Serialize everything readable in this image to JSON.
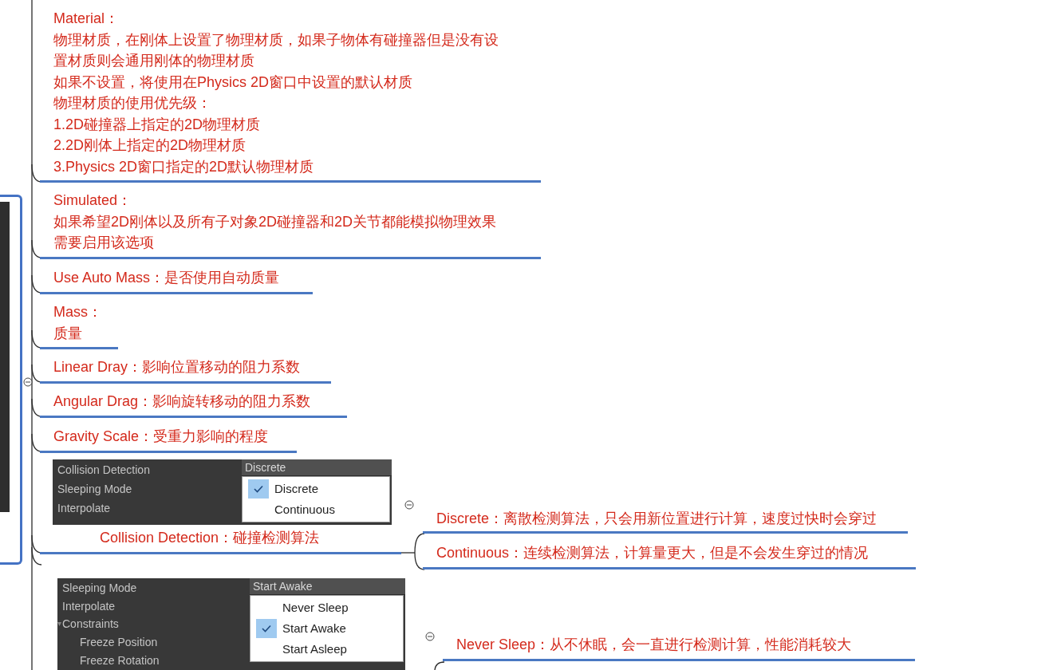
{
  "topics": [
    {
      "kind": "topic",
      "lines": [
        "Material：",
        "物理材质，在刚体上设置了物理材质，如果子物体有碰撞器但是没有设",
        "置材质则会通用刚体的物理材质",
        "如果不设置，将使用在Physics 2D窗口中设置的默认材质",
        "物理材质的使用优先级：",
        "1.2D碰撞器上指定的2D物理材质",
        "2.2D刚体上指定的2D物理材质",
        "3.Physics 2D窗口指定的2D默认物理材质"
      ]
    },
    {
      "kind": "topic",
      "lines": [
        "Simulated：",
        "如果希望2D刚体以及所有子对象2D碰撞器和2D关节都能模拟物理效果",
        "需要启用该选项"
      ]
    },
    {
      "kind": "topic",
      "lines": [
        "Use Auto Mass：是否使用自动质量"
      ]
    },
    {
      "kind": "topic",
      "lines": [
        "Mass：",
        "质量"
      ]
    },
    {
      "kind": "topic",
      "lines": [
        "Linear Dray：影响位置移动的阻力系数"
      ]
    },
    {
      "kind": "topic",
      "lines": [
        "Angular Drag：影响旋转移动的阻力系数"
      ]
    },
    {
      "kind": "topic",
      "lines": [
        "Gravity Scale：受重力影响的程度"
      ]
    },
    {
      "kind": "screenshot",
      "rows": [
        {
          "label": "Collision Detection"
        },
        {
          "label": "Sleeping Mode"
        },
        {
          "label": "Interpolate"
        }
      ],
      "dropdown": {
        "value": "Discrete",
        "options": [
          {
            "label": "Discrete",
            "selected": true
          },
          {
            "label": "Continuous",
            "selected": false
          }
        ]
      }
    },
    {
      "kind": "topic",
      "lines": [
        "Collision Detection：碰撞检测算法"
      ],
      "children": [
        {
          "lines": [
            "Discrete：离散检测算法，只会用新位置进行计算，速度过快时会穿过"
          ]
        },
        {
          "lines": [
            "Continuous：连续检测算法，计算量更大，但是不会发生穿过的情况"
          ]
        }
      ]
    },
    {
      "kind": "screenshot",
      "rows": [
        {
          "label": "Sleeping Mode"
        },
        {
          "label": "Interpolate"
        },
        {
          "label": "Constraints",
          "expanded": true,
          "children": [
            {
              "label": "Freeze Position"
            },
            {
              "label": "Freeze Rotation"
            }
          ]
        }
      ],
      "dropdown": {
        "value": "Start Awake",
        "options": [
          {
            "label": "Never Sleep",
            "selected": false
          },
          {
            "label": "Start Awake",
            "selected": true
          },
          {
            "label": "Start Asleep",
            "selected": false
          }
        ]
      },
      "children": [
        {
          "lines": [
            "Never Sleep：从不休眠，会一直进行检测计算，性能消耗较大"
          ]
        }
      ]
    }
  ]
}
